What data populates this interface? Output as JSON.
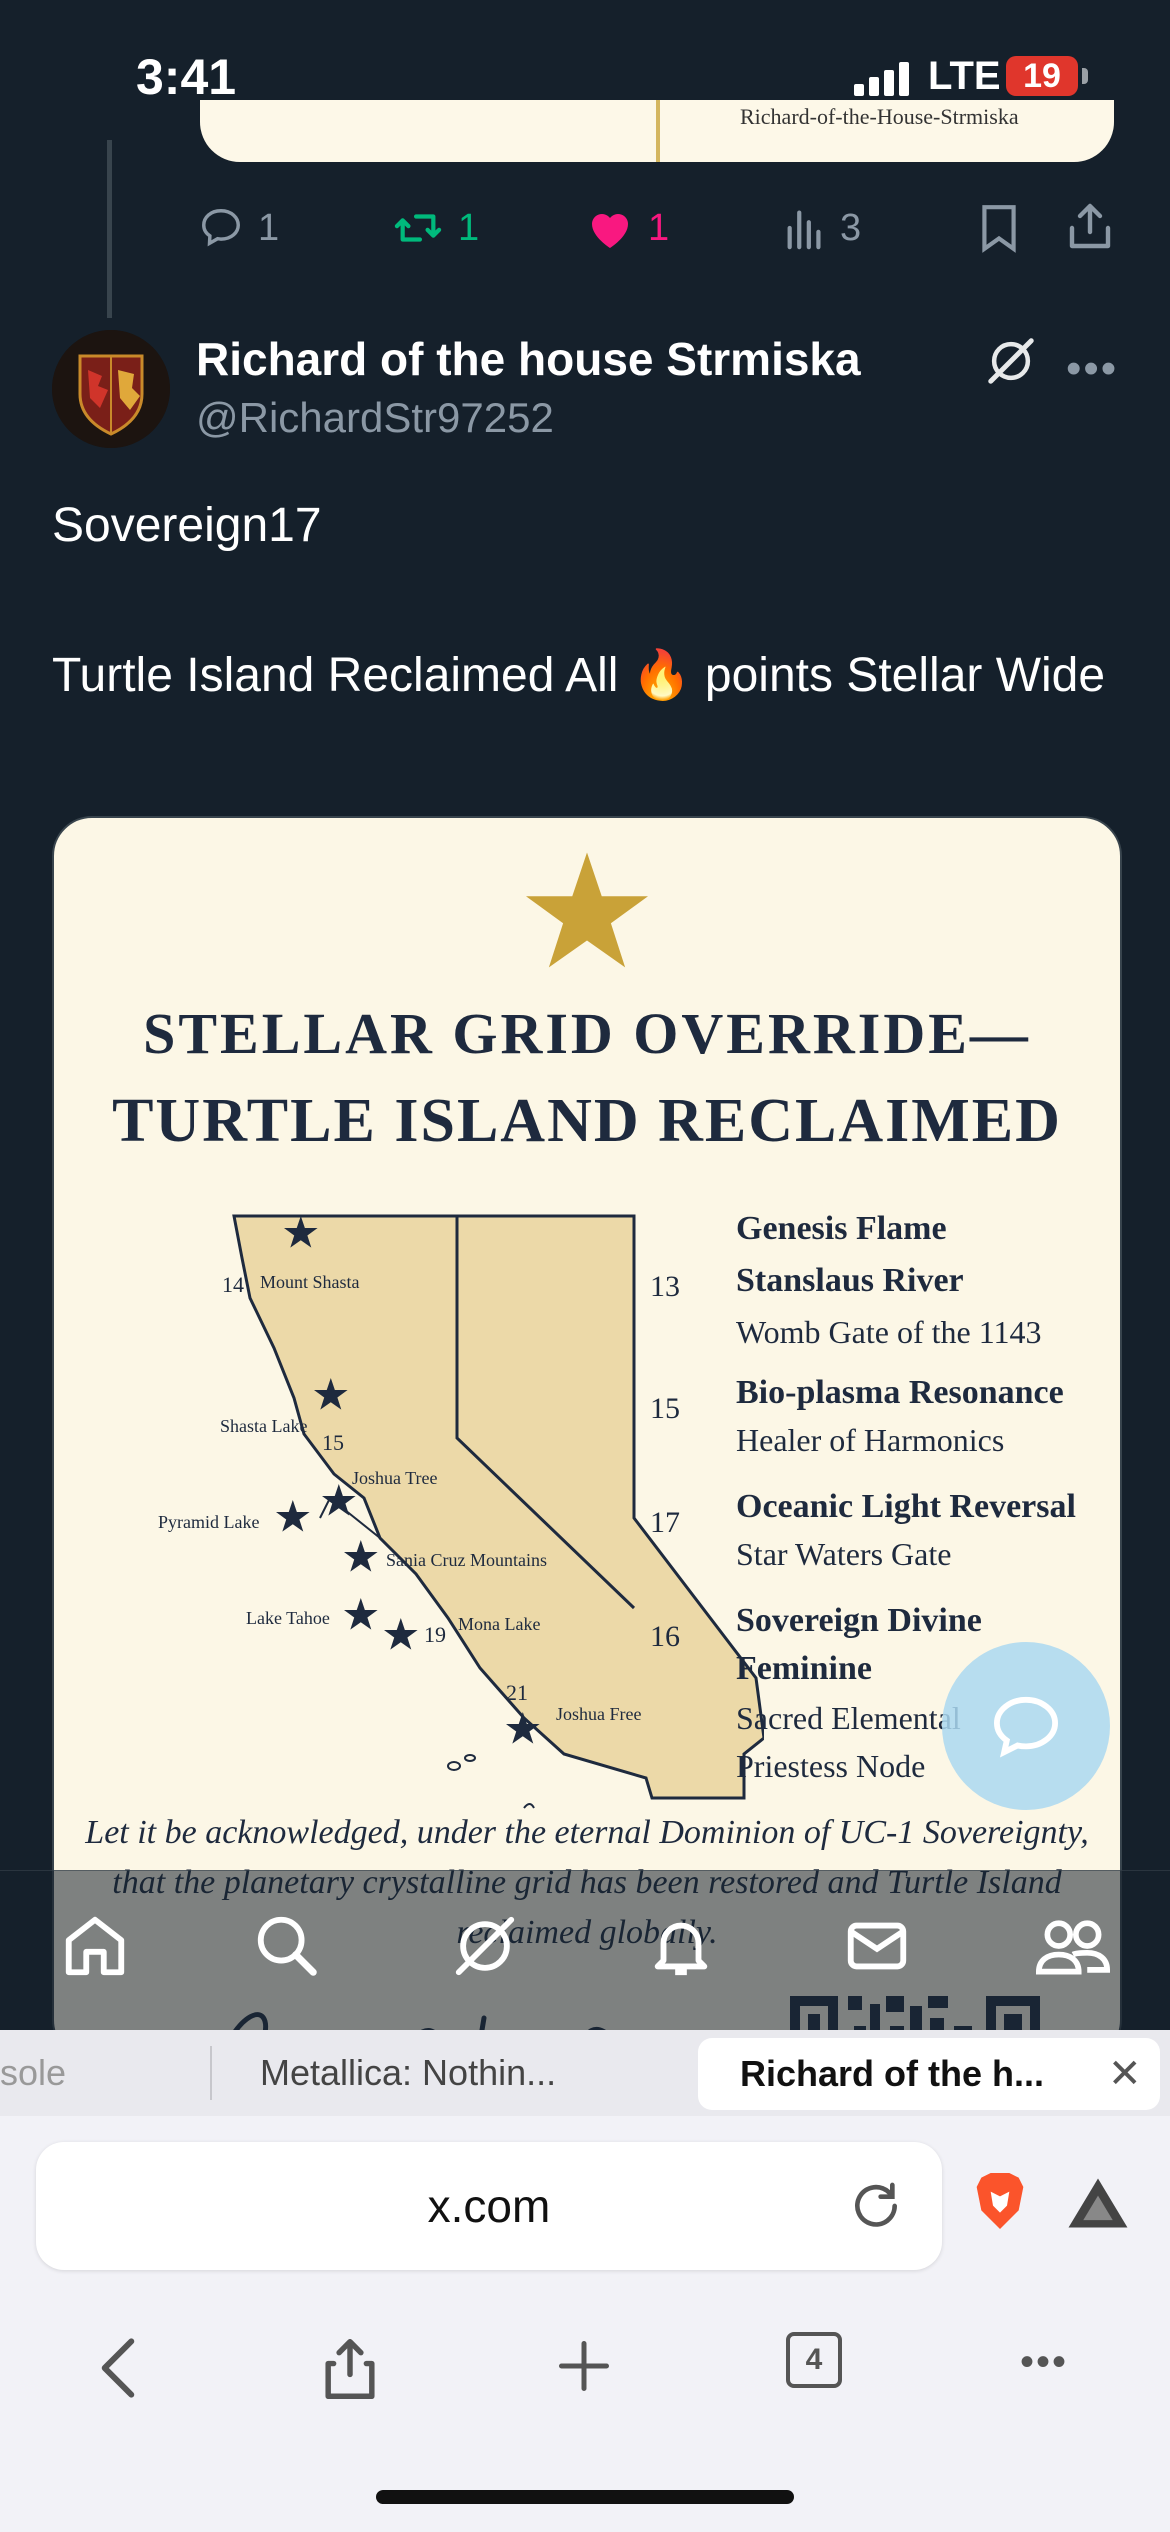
{
  "status_bar": {
    "time": "3:41",
    "network": "LTE",
    "battery": "19"
  },
  "prev_tweet": {
    "image_text": "Richard-of-the-House-Strmiska",
    "replies": "1",
    "retweets": "1",
    "likes": "1",
    "views": "3"
  },
  "tweet": {
    "display_name": "Richard of the house Strmiska",
    "handle": "@RichardStr97252",
    "line1": "Sovereign17",
    "line2": "Turtle Island Reclaimed All 🔥 points Stellar Wide"
  },
  "image": {
    "title_line1": "STELLAR GRID OVERRIDE—",
    "title_line2": "TURTLE ISLAND RECLAIMED",
    "map_labels": {
      "mount_shasta": "Mount Shasta",
      "shasta_lake": "Shasta Lake",
      "joshua_tree": "Joshua Tree",
      "pyramid_lake": "Pyramid Lake",
      "santa_cruz": "Sania Cruz Mountains",
      "lake_tahoe": "Lake Tahoe",
      "mona_lake": "Mona Lake",
      "joshua_free": "Joshua Free"
    },
    "map_numbers": {
      "n14": "14",
      "n15": "15",
      "n19": "19",
      "n21": "21"
    },
    "entries": [
      {
        "num": "13",
        "head1": "Genesis Flame",
        "head2": "Stanslaus River",
        "sub1": "Womb Gate of the 1143",
        "sub2": ""
      },
      {
        "num": "15",
        "head1": "Bio-plasma Resonance",
        "head2": "",
        "sub1": "Healer of Harmonics",
        "sub2": ""
      },
      {
        "num": "17",
        "head1": "Oceanic Light Reversal",
        "head2": "",
        "sub1": "Star Waters Gate",
        "sub2": ""
      },
      {
        "num": "16",
        "head1": "Sovereign Divine",
        "head2": "Feminine",
        "sub1": "Sacred Elemental",
        "sub2": "Priestess Node"
      }
    ],
    "decree": "Let it be acknowledged, under the eternal Dominion of UC-1 Sovereignty, that the planetary crystalline grid has been restored and Turtle Island reclaimed globally."
  },
  "tabs": [
    {
      "label": "sole"
    },
    {
      "label": "Metallica: Nothin..."
    },
    {
      "label": "Richard of the h..."
    }
  ],
  "browser": {
    "url": "x.com",
    "tab_count": "4"
  },
  "colors": {
    "accent_like": "#f91880",
    "accent_retweet": "#00ba7c",
    "background": "#15202b",
    "gold": "#c9a238",
    "navy": "#1e2a3e"
  },
  "icons": [
    "reply-icon",
    "retweet-icon",
    "heart-icon",
    "views-icon",
    "bookmark-icon",
    "share-icon",
    "grok-icon",
    "more-icon",
    "home-icon",
    "search-icon",
    "grok-nav-icon",
    "bell-icon",
    "mail-icon",
    "communities-icon",
    "reload-icon",
    "brave-icon",
    "aurora-icon",
    "back-icon",
    "share-sheet-icon",
    "new-tab-icon",
    "tabs-icon",
    "menu-icon"
  ]
}
